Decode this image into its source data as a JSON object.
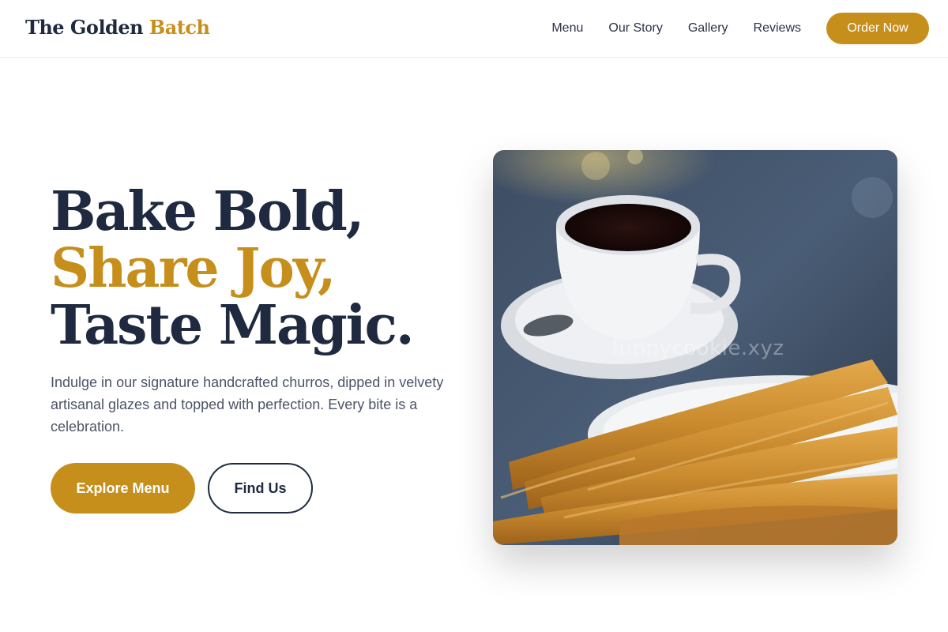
{
  "brand": {
    "name_part1": "The Golden",
    "name_part2": "Batch"
  },
  "nav": {
    "links": [
      "Menu",
      "Our Story",
      "Gallery",
      "Reviews"
    ],
    "cta_label": "Order Now"
  },
  "hero": {
    "title_line1": "Bake Bold,",
    "title_line2": "Share Joy,",
    "title_line3": "Taste Magic.",
    "description": "Indulge in our signature handcrafted churros, dipped in velvety artisanal glazes and topped with perfection. Every bite is a celebration.",
    "primary_button": "Explore Menu",
    "secondary_button": "Find Us",
    "image_watermark": "funnycookie.xyz"
  },
  "colors": {
    "accent": "#c68f1c",
    "navy": "#1f2a40",
    "body_text": "#4b5466"
  }
}
